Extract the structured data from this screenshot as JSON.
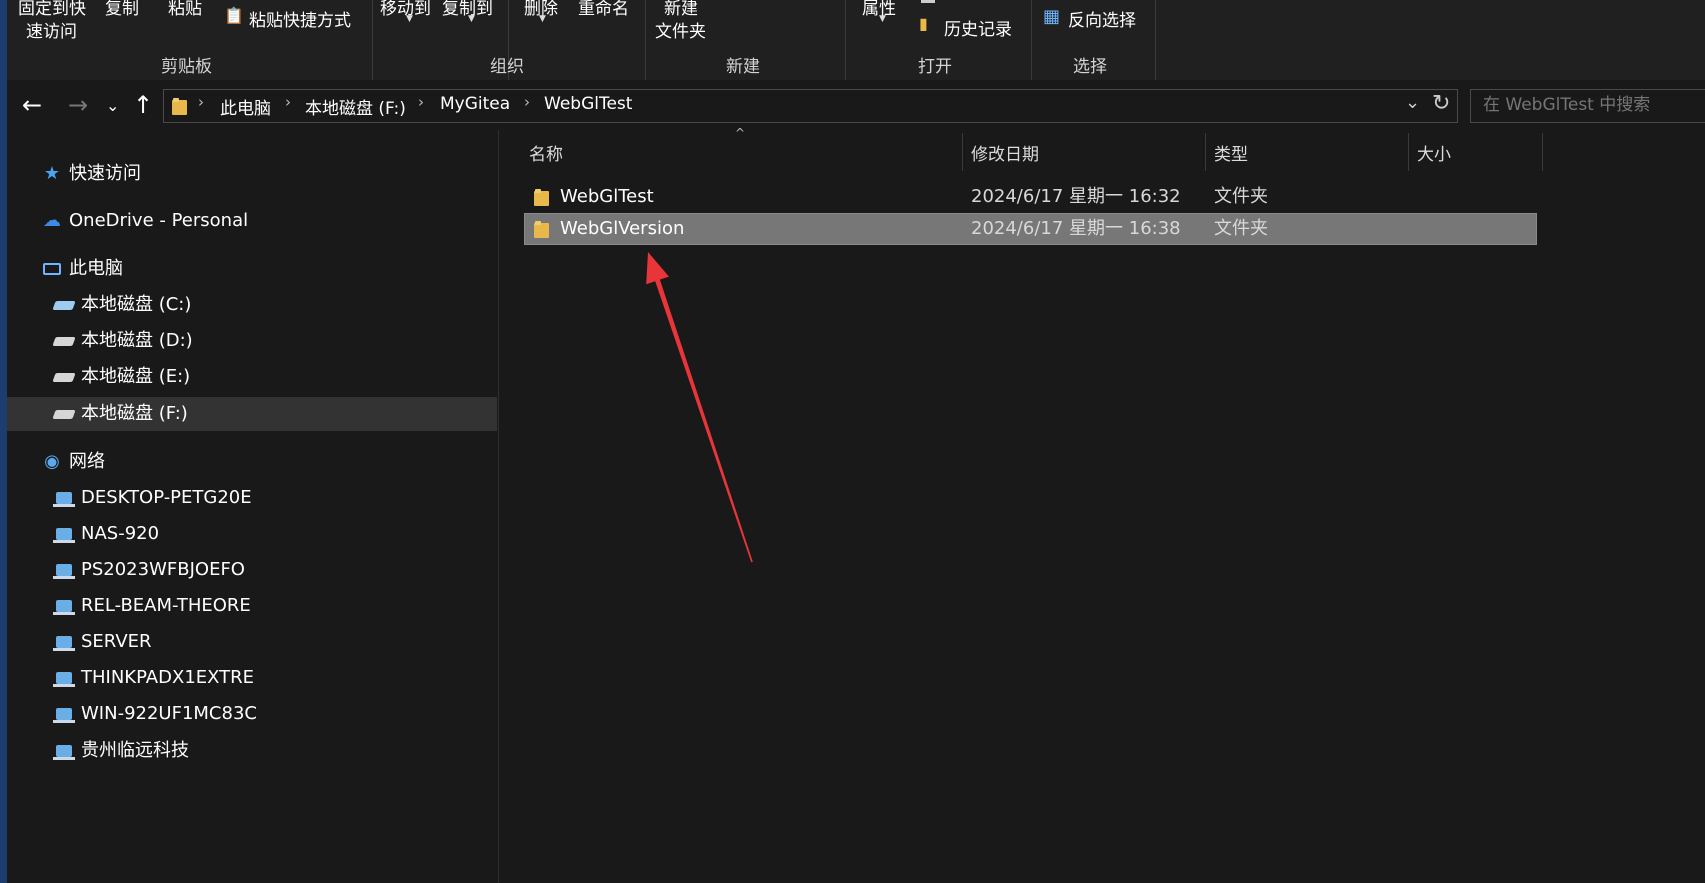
{
  "ribbon": {
    "clipboard": {
      "pin_line1": "固定到快",
      "pin_line2": "速访问",
      "copy": "复制",
      "paste": "粘贴",
      "paste_shortcut": "粘贴快捷方式",
      "group_label": "剪贴板"
    },
    "organize": {
      "move_to": "移动到",
      "copy_to": "复制到",
      "delete": "删除",
      "rename": "重命名",
      "group_label": "组织"
    },
    "new": {
      "new_folder_line1": "新建",
      "new_folder_line2": "文件夹",
      "group_label": "新建"
    },
    "open": {
      "properties": "属性",
      "history": "历史记录",
      "group_label": "打开"
    },
    "select": {
      "invert_selection": "反向选择",
      "group_label": "选择"
    }
  },
  "address": {
    "crumbs": [
      "此电脑",
      "本地磁盘 (F:)",
      "MyGitea",
      "WebGlTest"
    ]
  },
  "search": {
    "placeholder": "在 WebGlTest 中搜索"
  },
  "nav": {
    "quick_access": "快速访问",
    "onedrive": "OneDrive - Personal",
    "this_pc": "此电脑",
    "drives": [
      "本地磁盘 (C:)",
      "本地磁盘 (D:)",
      "本地磁盘 (E:)",
      "本地磁盘 (F:)"
    ],
    "network": "网络",
    "network_items": [
      "DESKTOP-PETG20E",
      "NAS-920",
      "PS2023WFBJOEFO",
      "REL-BEAM-THEORE",
      "SERVER",
      "THINKPADX1EXTRE",
      "WIN-922UF1MC83C",
      "贵州临远科技"
    ]
  },
  "columns": {
    "name": "名称",
    "modified": "修改日期",
    "type": "类型",
    "size": "大小"
  },
  "files": [
    {
      "name": "WebGlTest",
      "modified": "2024/6/17 星期一 16:32",
      "type": "文件夹",
      "size": ""
    },
    {
      "name": "WebGlVersion",
      "modified": "2024/6/17 星期一 16:38",
      "type": "文件夹",
      "size": ""
    }
  ],
  "colors": {
    "background": "#191919",
    "selection": "#777777",
    "annotation_arrow": "#e8353a"
  }
}
